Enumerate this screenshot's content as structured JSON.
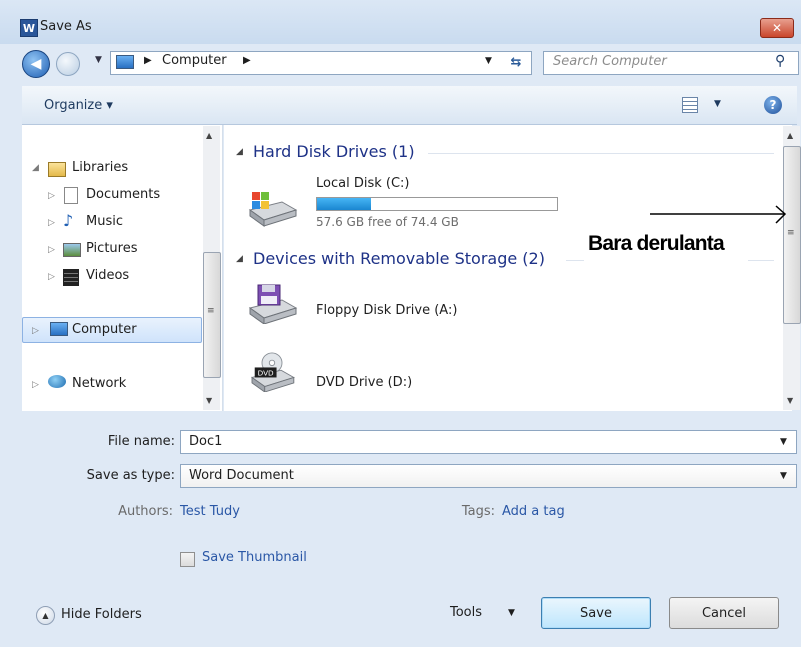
{
  "window": {
    "title": "Save As",
    "app_icon_letter": "W",
    "close_glyph": "✕"
  },
  "nav": {
    "breadcrumb": [
      "Computer"
    ],
    "search_placeholder": "Search Computer"
  },
  "toolbar": {
    "organize_label": "Organize ▾"
  },
  "navpane": {
    "items": [
      {
        "label": "Libraries",
        "icon": "library-folder-icon"
      },
      {
        "label": "Documents",
        "icon": "documents-icon"
      },
      {
        "label": "Music",
        "icon": "music-icon"
      },
      {
        "label": "Pictures",
        "icon": "pictures-icon"
      },
      {
        "label": "Videos",
        "icon": "videos-icon"
      },
      {
        "label": "Computer",
        "icon": "computer-icon",
        "selected": true
      },
      {
        "label": "Network",
        "icon": "network-icon"
      }
    ]
  },
  "content": {
    "groups": [
      {
        "title": "Hard Disk Drives (1)",
        "drives": [
          {
            "label": "Local Disk (C:)",
            "free_text": "57.6 GB free of 74.4 GB",
            "used_fraction": 0.226,
            "icon": "hard-disk-icon"
          }
        ]
      },
      {
        "title": "Devices with Removable Storage (2)",
        "drives": [
          {
            "label": "Floppy Disk Drive (A:)",
            "icon": "floppy-drive-icon"
          },
          {
            "label": "DVD Drive (D:)",
            "icon": "dvd-drive-icon",
            "badge": "DVD"
          }
        ]
      }
    ]
  },
  "annotation": {
    "text": "Bara derulanta"
  },
  "form": {
    "filename_label": "File name:",
    "filename_value": "Doc1",
    "saveastype_label": "Save as type:",
    "saveastype_value": "Word Document",
    "authors_label": "Authors:",
    "authors_value": "Test Tudy",
    "tags_label": "Tags:",
    "tags_value": "Add a tag",
    "thumbnail_label": "Save Thumbnail",
    "thumbnail_checked": false
  },
  "footer": {
    "hide_folders_label": "Hide Folders",
    "tools_label": "Tools",
    "save_label": "Save",
    "cancel_label": "Cancel"
  }
}
